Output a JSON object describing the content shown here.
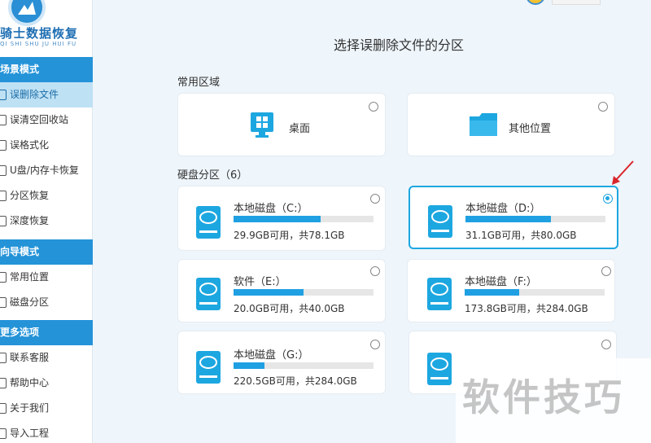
{
  "app": {
    "logo_title": "骑士数据恢复",
    "logo_subtitle": "QI SHI SHU JU HUI FU"
  },
  "sidebar": {
    "sections": [
      {
        "title": "场景模式",
        "items": [
          {
            "label": "误删除文件",
            "active": true
          },
          {
            "label": "误清空回收站"
          },
          {
            "label": "误格式化"
          },
          {
            "label": "U盘/内存卡恢复"
          },
          {
            "label": "分区恢复"
          },
          {
            "label": "深度恢复"
          }
        ]
      },
      {
        "title": "向导模式",
        "items": [
          {
            "label": "常用位置"
          },
          {
            "label": "磁盘分区"
          }
        ]
      },
      {
        "title": "更多选项",
        "items": [
          {
            "label": "联系客服"
          },
          {
            "label": "帮助中心"
          },
          {
            "label": "关于我们"
          },
          {
            "label": "导入工程"
          }
        ]
      }
    ]
  },
  "main": {
    "title": "选择误删除文件的分区",
    "common_group_label": "常用区域",
    "common_items": [
      {
        "label": "桌面",
        "icon": "windows-desktop-icon"
      },
      {
        "label": "其他位置",
        "icon": "folder-icon"
      }
    ],
    "disk_group_label": "硬盘分区（6）",
    "partitions": [
      {
        "name": "本地磁盘（C:）",
        "capacity_text": "29.9GB可用，共78.1GB",
        "used_fraction": 0.62,
        "selected": false
      },
      {
        "name": "本地磁盘（D:）",
        "capacity_text": "31.1GB可用，共80.0GB",
        "used_fraction": 0.61,
        "selected": true
      },
      {
        "name": "软件（E:）",
        "capacity_text": "20.0GB可用，共40.0GB",
        "used_fraction": 0.5,
        "selected": false
      },
      {
        "name": "本地磁盘（F:）",
        "capacity_text": "173.8GB可用，共284.0GB",
        "used_fraction": 0.39,
        "selected": false
      },
      {
        "name": "本地磁盘（G:）",
        "capacity_text": "220.5GB可用，共284.0GB",
        "used_fraction": 0.22,
        "selected": false
      }
    ]
  },
  "watermark": "软件技巧",
  "colors": {
    "accent": "#1fa0e2",
    "section_header": "#2493d8",
    "active_item_bg": "#bfe1f4",
    "selected_border": "#1da7e0",
    "arrow": "#d9252a"
  }
}
